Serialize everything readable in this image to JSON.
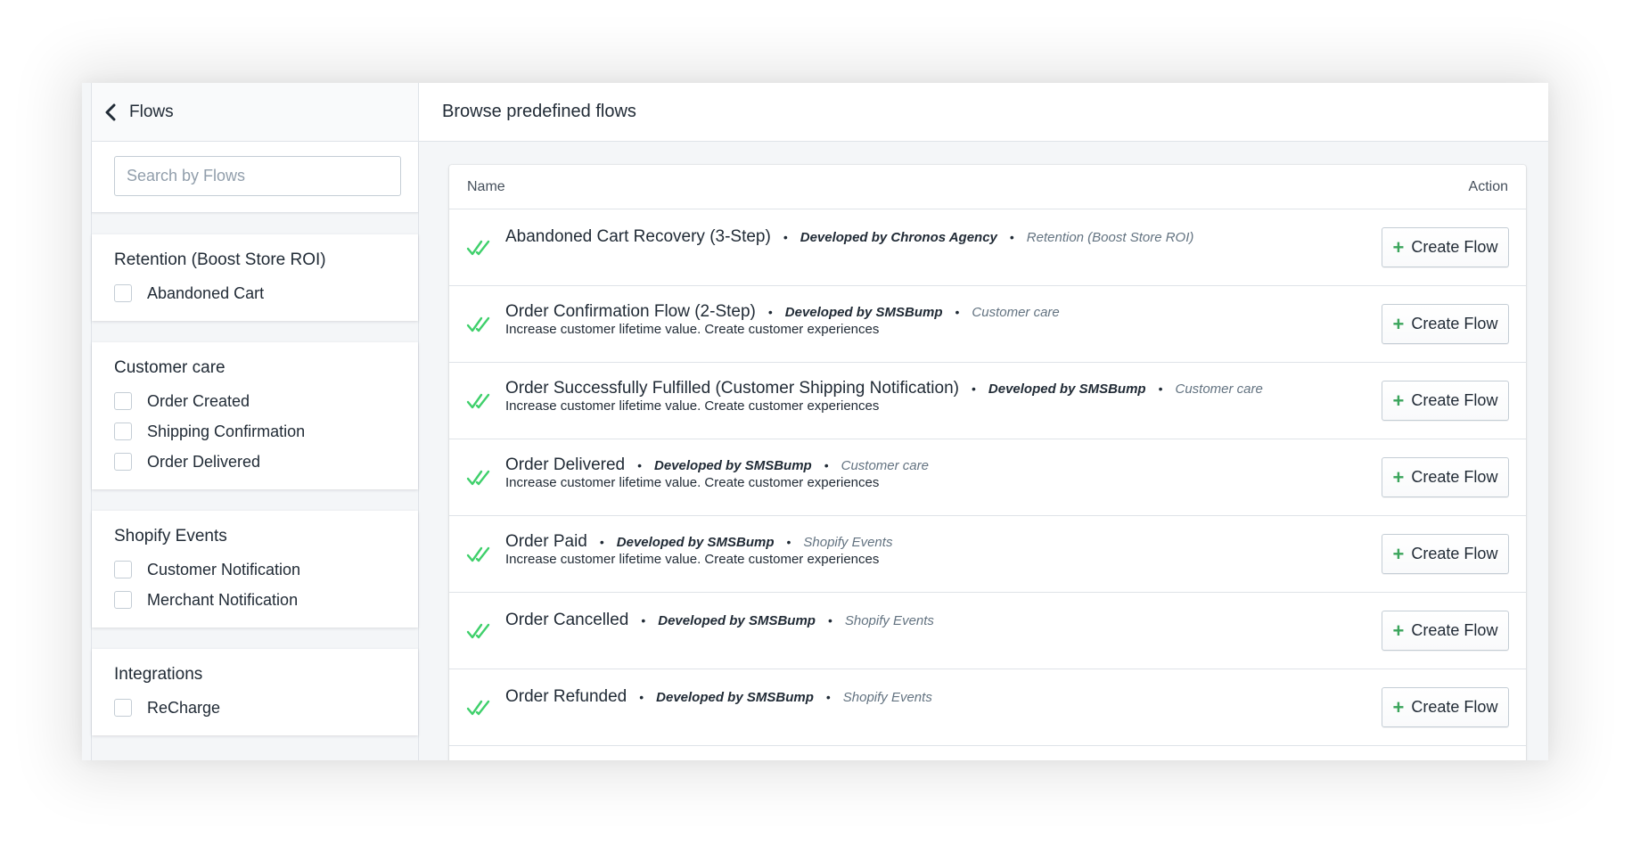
{
  "sidebar": {
    "back_label": "Flows",
    "search_placeholder": "Search by Flows",
    "groups": [
      {
        "title": "Retention (Boost Store ROI)",
        "items": [
          "Abandoned Cart"
        ]
      },
      {
        "title": "Customer care",
        "items": [
          "Order Created",
          "Shipping Confirmation",
          "Order Delivered"
        ]
      },
      {
        "title": "Shopify Events",
        "items": [
          "Customer Notification",
          "Merchant Notification"
        ]
      },
      {
        "title": "Integrations",
        "items": [
          "ReCharge"
        ]
      }
    ]
  },
  "main": {
    "title": "Browse predefined flows",
    "columns": {
      "name": "Name",
      "action": "Action"
    },
    "button_label": "Create Flow",
    "check_color": "#3fd06b",
    "flows": [
      {
        "name": "Abandoned Cart Recovery (3-Step)",
        "developer": "Developed by Chronos Agency",
        "category": "Retention (Boost Store ROI)",
        "description": ""
      },
      {
        "name": "Order Confirmation Flow (2-Step)",
        "developer": "Developed by SMSBump",
        "category": "Customer care",
        "description": "Increase customer lifetime value. Create customer experiences"
      },
      {
        "name": "Order Successfully Fulfilled (Customer Shipping Notification)",
        "developer": "Developed by SMSBump",
        "category": "Customer care",
        "description": "Increase customer lifetime value. Create customer experiences"
      },
      {
        "name": "Order Delivered",
        "developer": "Developed by SMSBump",
        "category": "Customer care",
        "description": "Increase customer lifetime value. Create customer experiences"
      },
      {
        "name": "Order Paid",
        "developer": "Developed by SMSBump",
        "category": "Shopify Events",
        "description": "Increase customer lifetime value. Create customer experiences"
      },
      {
        "name": "Order Cancelled",
        "developer": "Developed by SMSBump",
        "category": "Shopify Events",
        "description": ""
      },
      {
        "name": "Order Refunded",
        "developer": "Developed by SMSBump",
        "category": "Shopify Events",
        "description": ""
      }
    ]
  }
}
